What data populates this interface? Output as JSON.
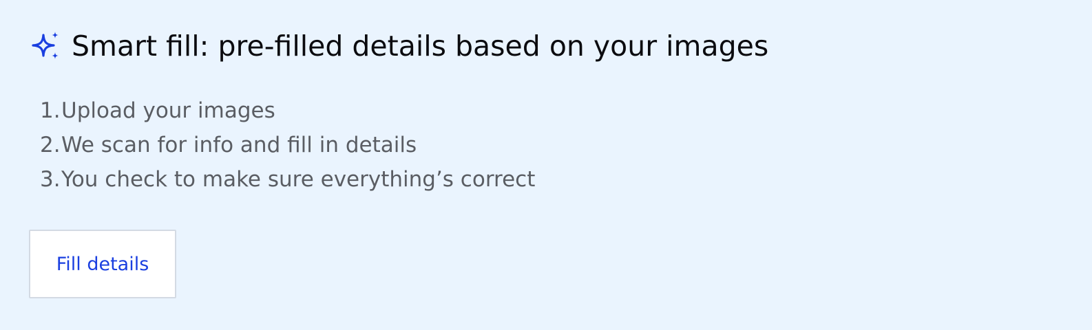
{
  "header": {
    "icon": "sparkle-icon",
    "accent_color": "#1a3fe0",
    "title": "Smart fill: pre-filled details based on your images"
  },
  "steps": [
    {
      "num": "1.",
      "text": "Upload your images"
    },
    {
      "num": "2.",
      "text": "We scan for info and fill in details"
    },
    {
      "num": "3.",
      "text": "You check to make sure everything’s correct"
    }
  ],
  "actions": {
    "fill_details_label": "Fill details"
  }
}
